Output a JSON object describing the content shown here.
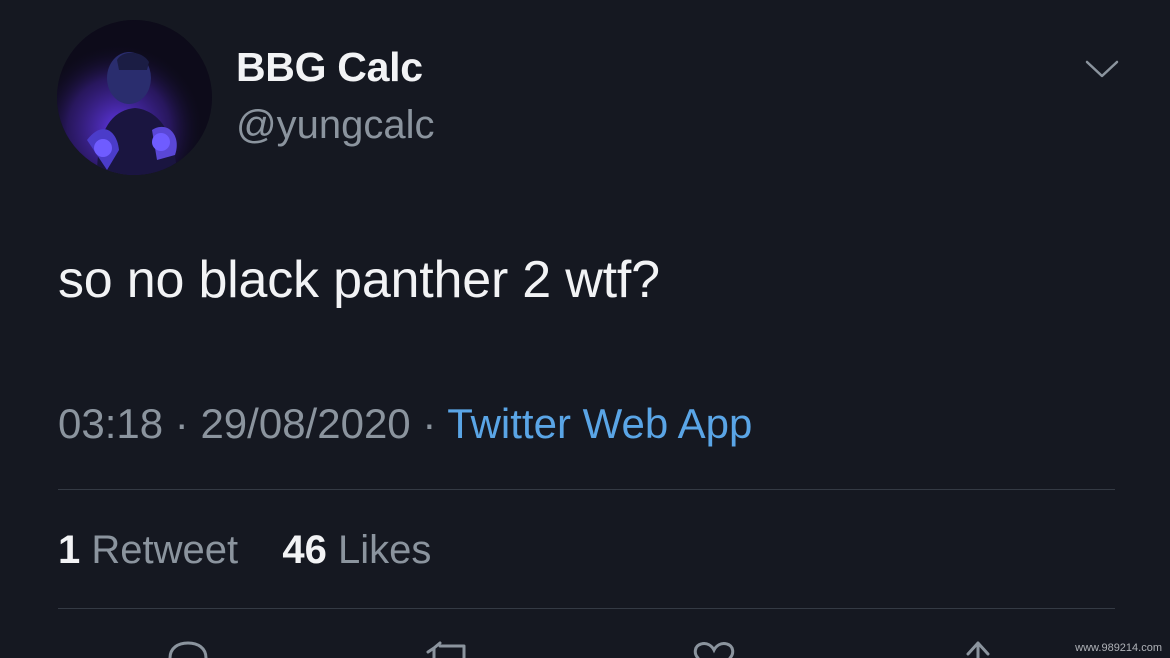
{
  "author": {
    "display_name": "BBG Calc",
    "handle": "@yungcalc"
  },
  "tweet": {
    "text": "so no black panther 2 wtf?",
    "time": "03:18",
    "date": "29/08/2020",
    "separator": "·",
    "source": "Twitter Web App"
  },
  "stats": {
    "retweets_count": "1",
    "retweets_label": "Retweet",
    "likes_count": "46",
    "likes_label": "Likes"
  },
  "icons": {
    "menu": "chevron-down-icon",
    "reply": "reply-icon",
    "retweet": "retweet-icon",
    "like": "heart-icon",
    "share": "share-icon"
  },
  "watermark": "www.989214.com",
  "colors": {
    "background": "#151821",
    "text_primary": "#f2f3f5",
    "text_secondary": "#8b949e",
    "link": "#5aa5e6",
    "divider": "#343a44"
  }
}
